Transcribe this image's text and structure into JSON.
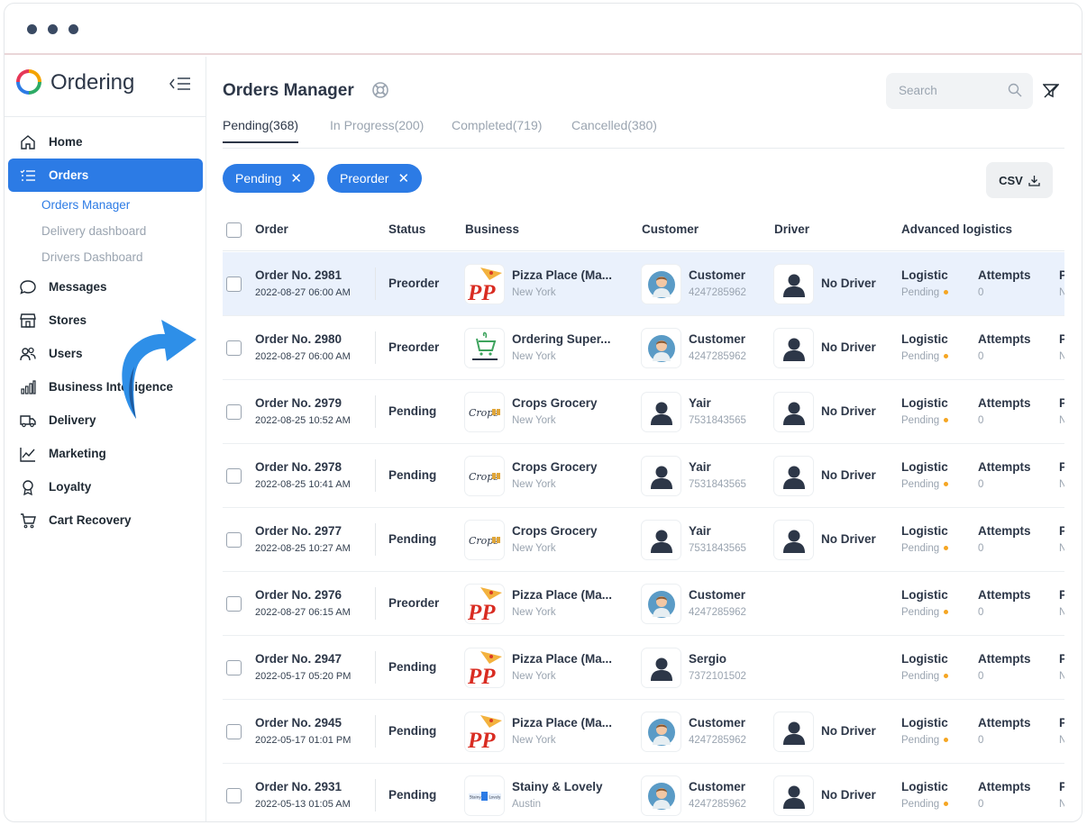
{
  "app": {
    "logo_text": "Ordering"
  },
  "sidebar": {
    "items": [
      {
        "label": "Home",
        "icon": "home-icon"
      },
      {
        "label": "Orders",
        "icon": "list-icon",
        "active": true
      },
      {
        "label": "Messages",
        "icon": "chat-icon"
      },
      {
        "label": "Stores",
        "icon": "store-icon"
      },
      {
        "label": "Users",
        "icon": "users-icon"
      },
      {
        "label": "Business Intelligence",
        "icon": "bar-chart-icon"
      },
      {
        "label": "Delivery",
        "icon": "truck-icon"
      },
      {
        "label": "Marketing",
        "icon": "trend-icon"
      },
      {
        "label": "Loyalty",
        "icon": "award-icon"
      },
      {
        "label": "Cart Recovery",
        "icon": "cart-icon"
      }
    ],
    "orders_sub": [
      "Orders Manager",
      "Delivery dashboard",
      "Drivers Dashboard"
    ]
  },
  "header": {
    "title": "Orders Manager",
    "search_placeholder": "Search"
  },
  "tabs": [
    "Pending(368)",
    "In Progress(200)",
    "Completed(719)",
    "Cancelled(380)"
  ],
  "chips": [
    "Pending",
    "Preorder"
  ],
  "csv_label": "CSV",
  "columns": [
    "Order",
    "Status",
    "Business",
    "Customer",
    "Driver",
    "Advanced logistics"
  ],
  "orders": [
    {
      "no": "Order No. 2981",
      "date": "2022-08-27 06:00 AM",
      "status": "Preorder",
      "business": "Pizza Place (Ma...",
      "city": "New York",
      "logo": "pp",
      "customer": "Customer",
      "phone": "4247285962",
      "cust_avatar": "photo",
      "driver": "No Driver",
      "logistic": "Logistic",
      "logistic_status": "Pending",
      "attempts_label": "Attempts",
      "attempts": "0",
      "pr": "Pr",
      "prv": "No"
    },
    {
      "no": "Order No. 2980",
      "date": "2022-08-27 06:00 AM",
      "status": "Preorder",
      "business": "Ordering Super...",
      "city": "New York",
      "logo": "super",
      "customer": "Customer",
      "phone": "4247285962",
      "cust_avatar": "photo",
      "driver": "No Driver",
      "logistic": "Logistic",
      "logistic_status": "Pending",
      "attempts_label": "Attempts",
      "attempts": "0",
      "pr": "Pr",
      "prv": "No"
    },
    {
      "no": "Order No. 2979",
      "date": "2022-08-25 10:52 AM",
      "status": "Pending",
      "business": "Crops Grocery",
      "city": "New York",
      "logo": "crops",
      "customer": "Yair",
      "phone": "7531843565",
      "cust_avatar": "person",
      "driver": "No Driver",
      "logistic": "Logistic",
      "logistic_status": "Pending",
      "attempts_label": "Attempts",
      "attempts": "0",
      "pr": "Pr",
      "prv": "No"
    },
    {
      "no": "Order No. 2978",
      "date": "2022-08-25 10:41 AM",
      "status": "Pending",
      "business": "Crops Grocery",
      "city": "New York",
      "logo": "crops",
      "customer": "Yair",
      "phone": "7531843565",
      "cust_avatar": "person",
      "driver": "No Driver",
      "logistic": "Logistic",
      "logistic_status": "Pending",
      "attempts_label": "Attempts",
      "attempts": "0",
      "pr": "Pr",
      "prv": "No"
    },
    {
      "no": "Order No. 2977",
      "date": "2022-08-25 10:27 AM",
      "status": "Pending",
      "business": "Crops Grocery",
      "city": "New York",
      "logo": "crops",
      "customer": "Yair",
      "phone": "7531843565",
      "cust_avatar": "person",
      "driver": "No Driver",
      "logistic": "Logistic",
      "logistic_status": "Pending",
      "attempts_label": "Attempts",
      "attempts": "0",
      "pr": "Pr",
      "prv": "No"
    },
    {
      "no": "Order No. 2976",
      "date": "2022-08-27 06:15 AM",
      "status": "Preorder",
      "business": "Pizza Place (Ma...",
      "city": "New York",
      "logo": "pp",
      "customer": "Customer",
      "phone": "4247285962",
      "cust_avatar": "photo",
      "driver": "",
      "logistic": "Logistic",
      "logistic_status": "Pending",
      "attempts_label": "Attempts",
      "attempts": "0",
      "pr": "Pr",
      "prv": "No"
    },
    {
      "no": "Order No. 2947",
      "date": "2022-05-17 05:20 PM",
      "status": "Pending",
      "business": "Pizza Place (Ma...",
      "city": "New York",
      "logo": "pp",
      "customer": "Sergio",
      "phone": "7372101502",
      "cust_avatar": "person",
      "driver": "",
      "logistic": "Logistic",
      "logistic_status": "Pending",
      "attempts_label": "Attempts",
      "attempts": "0",
      "pr": "Pr",
      "prv": "No"
    },
    {
      "no": "Order No. 2945",
      "date": "2022-05-17 01:01 PM",
      "status": "Pending",
      "business": "Pizza Place (Ma...",
      "city": "New York",
      "logo": "pp",
      "customer": "Customer",
      "phone": "4247285962",
      "cust_avatar": "photo",
      "driver": "No Driver",
      "logistic": "Logistic",
      "logistic_status": "Pending",
      "attempts_label": "Attempts",
      "attempts": "0",
      "pr": "Pr",
      "prv": "No"
    },
    {
      "no": "Order No. 2931",
      "date": "2022-05-13 01:05 AM",
      "status": "Pending",
      "business": "Stainy & Lovely",
      "city": "Austin",
      "logo": "stainy",
      "customer": "Customer",
      "phone": "4247285962",
      "cust_avatar": "photo",
      "driver": "No Driver",
      "logistic": "Logistic",
      "logistic_status": "Pending",
      "attempts_label": "Attempts",
      "attempts": "0",
      "pr": "Pr",
      "prv": "No"
    }
  ],
  "colors": {
    "accent": "#2c7be5",
    "pending_dot": "#f5a623",
    "selected_row": "#eaf1fc"
  }
}
